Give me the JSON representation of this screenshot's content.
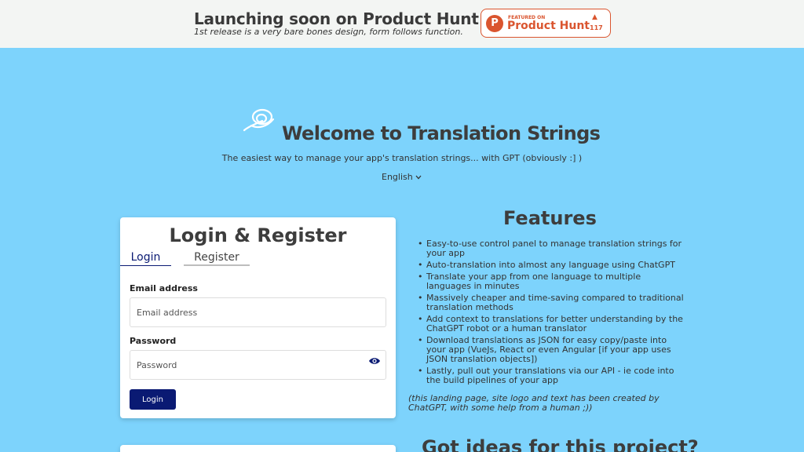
{
  "banner": {
    "title": "Launching soon on Product Hunt ->",
    "subtitle": "1st release is a very bare bones design, form follows function.",
    "badge": {
      "featured": "FEATURED ON",
      "name": "Product Hunt",
      "logo_letter": "P",
      "arrow": "▲",
      "count": "117"
    }
  },
  "hero": {
    "title": "Welcome to Translation Strings",
    "subtitle": "The easiest way to manage your app's translation strings... with GPT (obviously :] )",
    "language": "English"
  },
  "auth": {
    "title": "Login & Register",
    "tabs": {
      "login": "Login",
      "register": "Register"
    },
    "email_label": "Email address",
    "email_placeholder": "Email address",
    "password_label": "Password",
    "password_placeholder": "Password",
    "submit": "Login"
  },
  "features": {
    "title": "Features",
    "items": [
      "Easy-to-use control panel to manage translation strings for your app",
      "Auto-translation into almost any language using ChatGPT",
      "Translate your app from one language to multiple languages in minutes",
      "Massively cheaper and time-saving compared to traditional translation methods",
      "Add context to translations for better understanding by the ChatGPT robot or a human translator",
      "Download translations as JSON for easy copy/paste into your app (VueJs, React or even Angular [if your app uses JSON translation objects])",
      "Lastly, pull out your translations via our API - ie code into the build pipelines of your app"
    ],
    "footnote": "(this landing page, site logo and text has been created by ChatGPT, with some help from a human ;))"
  },
  "ideas": {
    "title": "Got ideas for this project?"
  },
  "colors": {
    "background": "#7dd3fc",
    "banner": "#f3f5f3",
    "product_hunt": "#da552f",
    "primary": "#0a1a73"
  },
  "icons": [
    "site-logo-icon",
    "chevron-down-icon",
    "eye-icon",
    "product-hunt-logo-icon",
    "upvote-arrow-icon"
  ]
}
